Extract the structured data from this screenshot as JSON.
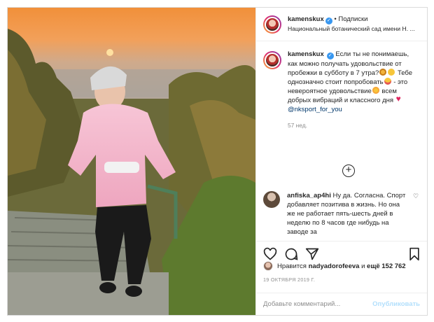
{
  "post": {
    "username": "kamenskux",
    "follow_label": "Подписки",
    "separator": "•",
    "location": "Национальный ботанический сад имени Н. ..."
  },
  "caption": {
    "username": "kamenskux",
    "part1": "Если ты не понимаешь, как можно получать удовольствие от пробежки в субботу в 7 утра?",
    "part2": " Тебе однозначно стоит попробовать",
    "part3": " - это невероятное удовольствие",
    "part4": " всем добрых вибраций и классного дня",
    "mention": "@nksport_for_you",
    "time_ago": "57 нед."
  },
  "comment": {
    "username": "anfiska_ap4hi",
    "text": "Ну да. Согласна. Спорт добавляет позитива в жизнь. Но она же не работает пять-шесть дней в неделю по 8 часов где нибудь на заводе за"
  },
  "likes": {
    "prefix": "Нравится",
    "user": "nadyadorofeeva",
    "and": "и",
    "others": "ещё 152 762"
  },
  "date": "19 ОКТЯБРЯ 2019 Г.",
  "add_comment": {
    "placeholder": "Добавьте комментарий...",
    "publish_label": "Опубликовать"
  },
  "icons": {
    "verified": "verified-badge-icon",
    "heart": "heart-icon",
    "comment": "comment-icon",
    "share": "share-icon",
    "bookmark": "bookmark-icon",
    "more": "plus-circle-icon"
  }
}
